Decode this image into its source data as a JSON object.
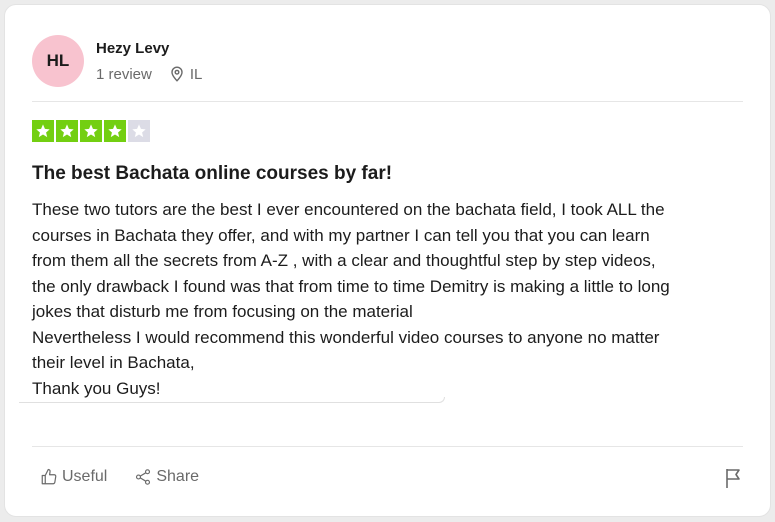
{
  "reviewer": {
    "initials": "HL",
    "name": "Hezy Levy",
    "review_count": "1 review",
    "country": "IL",
    "avatar_color": "#f8c3cf"
  },
  "rating": {
    "stars": 4,
    "max": 5,
    "filled_color": "#73cf11",
    "empty_color": "#dcdce6"
  },
  "review": {
    "title": "The best Bachata online courses by far!",
    "lines": [
      "These two tutors are the best I ever encountered on the bachata field, I took ALL the",
      "courses in Bachata they offer, and with my partner I can tell you that you can learn",
      "from them all the secrets from A-Z , with a clear and thoughtful step by step videos,",
      "the only drawback I found was that from time to time Demitry is making a little to long",
      "jokes that disturb me from focusing on the material",
      "Nevertheless I would recommend this wonderful video courses to anyone no matter",
      "their level in Bachata,",
      "Thank you Guys!"
    ]
  },
  "actions": {
    "useful_label": "Useful",
    "share_label": "Share",
    "useful_icon": "thumbs-up-icon",
    "share_icon": "share-icon",
    "flag_icon": "flag-icon"
  }
}
